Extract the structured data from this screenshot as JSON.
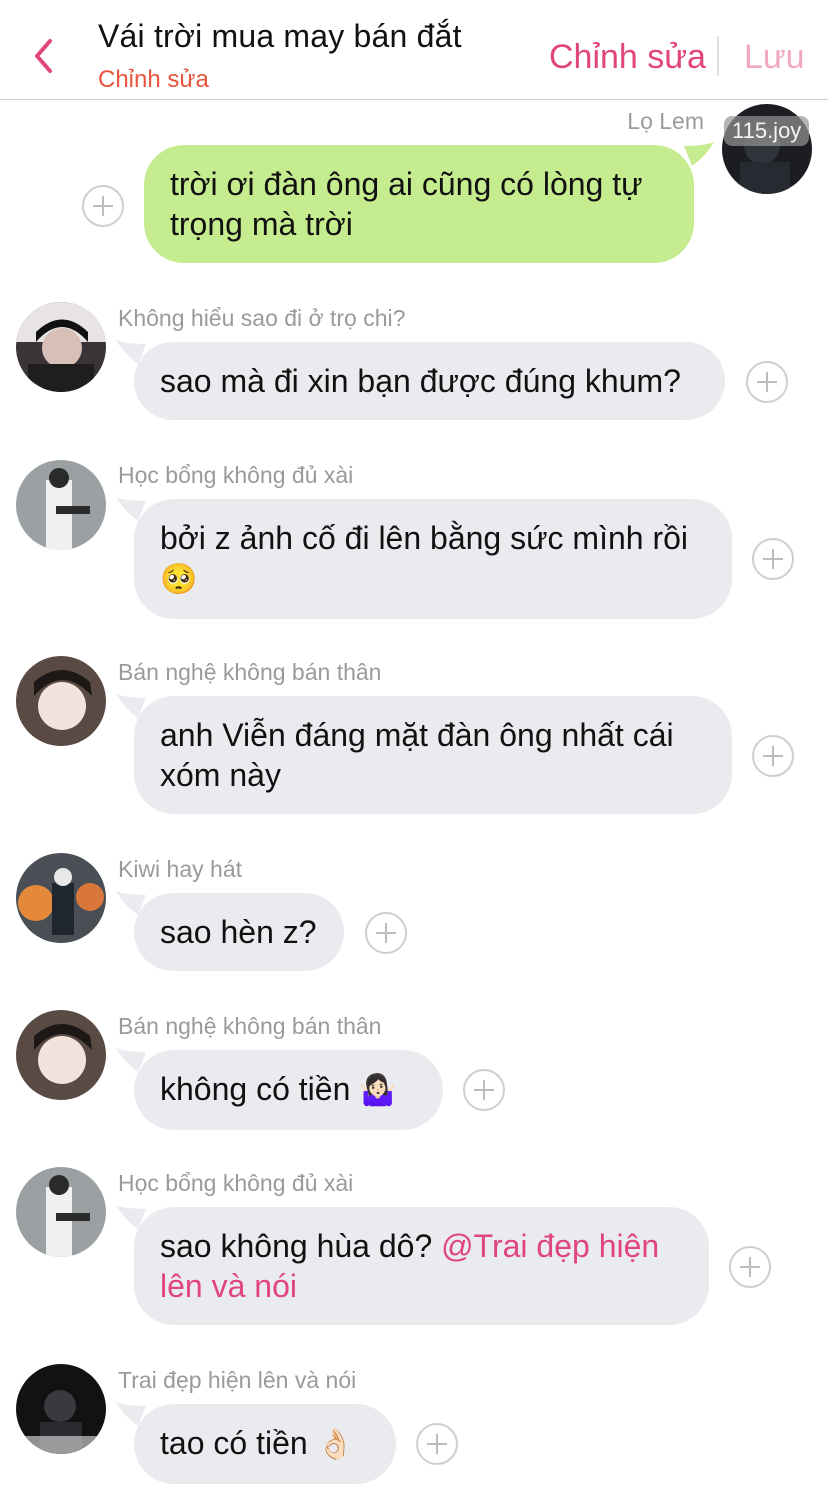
{
  "header": {
    "title": "Vái trời mua may bán đắt",
    "subtitle": "Chỉnh sửa",
    "edit_label": "Chỉnh sửa",
    "save_label": "Lưu"
  },
  "messages": [
    {
      "sender": "Lọ Lem",
      "badge": "115.joy",
      "text": "trời ơi đàn ông ai cũng có lòng tự trọng mà trời",
      "mine": true
    },
    {
      "sender": "Không hiểu sao đi ở trọ chi?",
      "text": "sao mà đi xin bạn được đúng khum?"
    },
    {
      "sender": "Học bổng không đủ xài",
      "text": "bởi z ảnh cố đi lên bằng sức mình rồi",
      "emoji": "🥺"
    },
    {
      "sender": "Bán nghệ không bán thân",
      "text": "anh Viễn đáng mặt đàn ông nhất cái xóm này"
    },
    {
      "sender": "Kiwi hay hát",
      "text": "sao hèn z?"
    },
    {
      "sender": "Bán nghệ không bán thân",
      "text": "không có tiền",
      "emoji": "🤷🏻‍♀️"
    },
    {
      "sender": "Học bổng không đủ xài",
      "text": "sao không hùa dô?",
      "mention": "@Trai đẹp hiện lên và nói"
    },
    {
      "sender": "Trai đẹp hiện lên và nói",
      "text": "tao có tiền",
      "emoji": "👌🏻"
    }
  ],
  "colors": {
    "accent": "#e0457e",
    "subtitle": "#e8543c",
    "my_bubble": "#c6ec90",
    "other_bubble": "#e9ebee"
  },
  "icons": [
    "back-chevron-icon",
    "add-reaction-icon"
  ]
}
